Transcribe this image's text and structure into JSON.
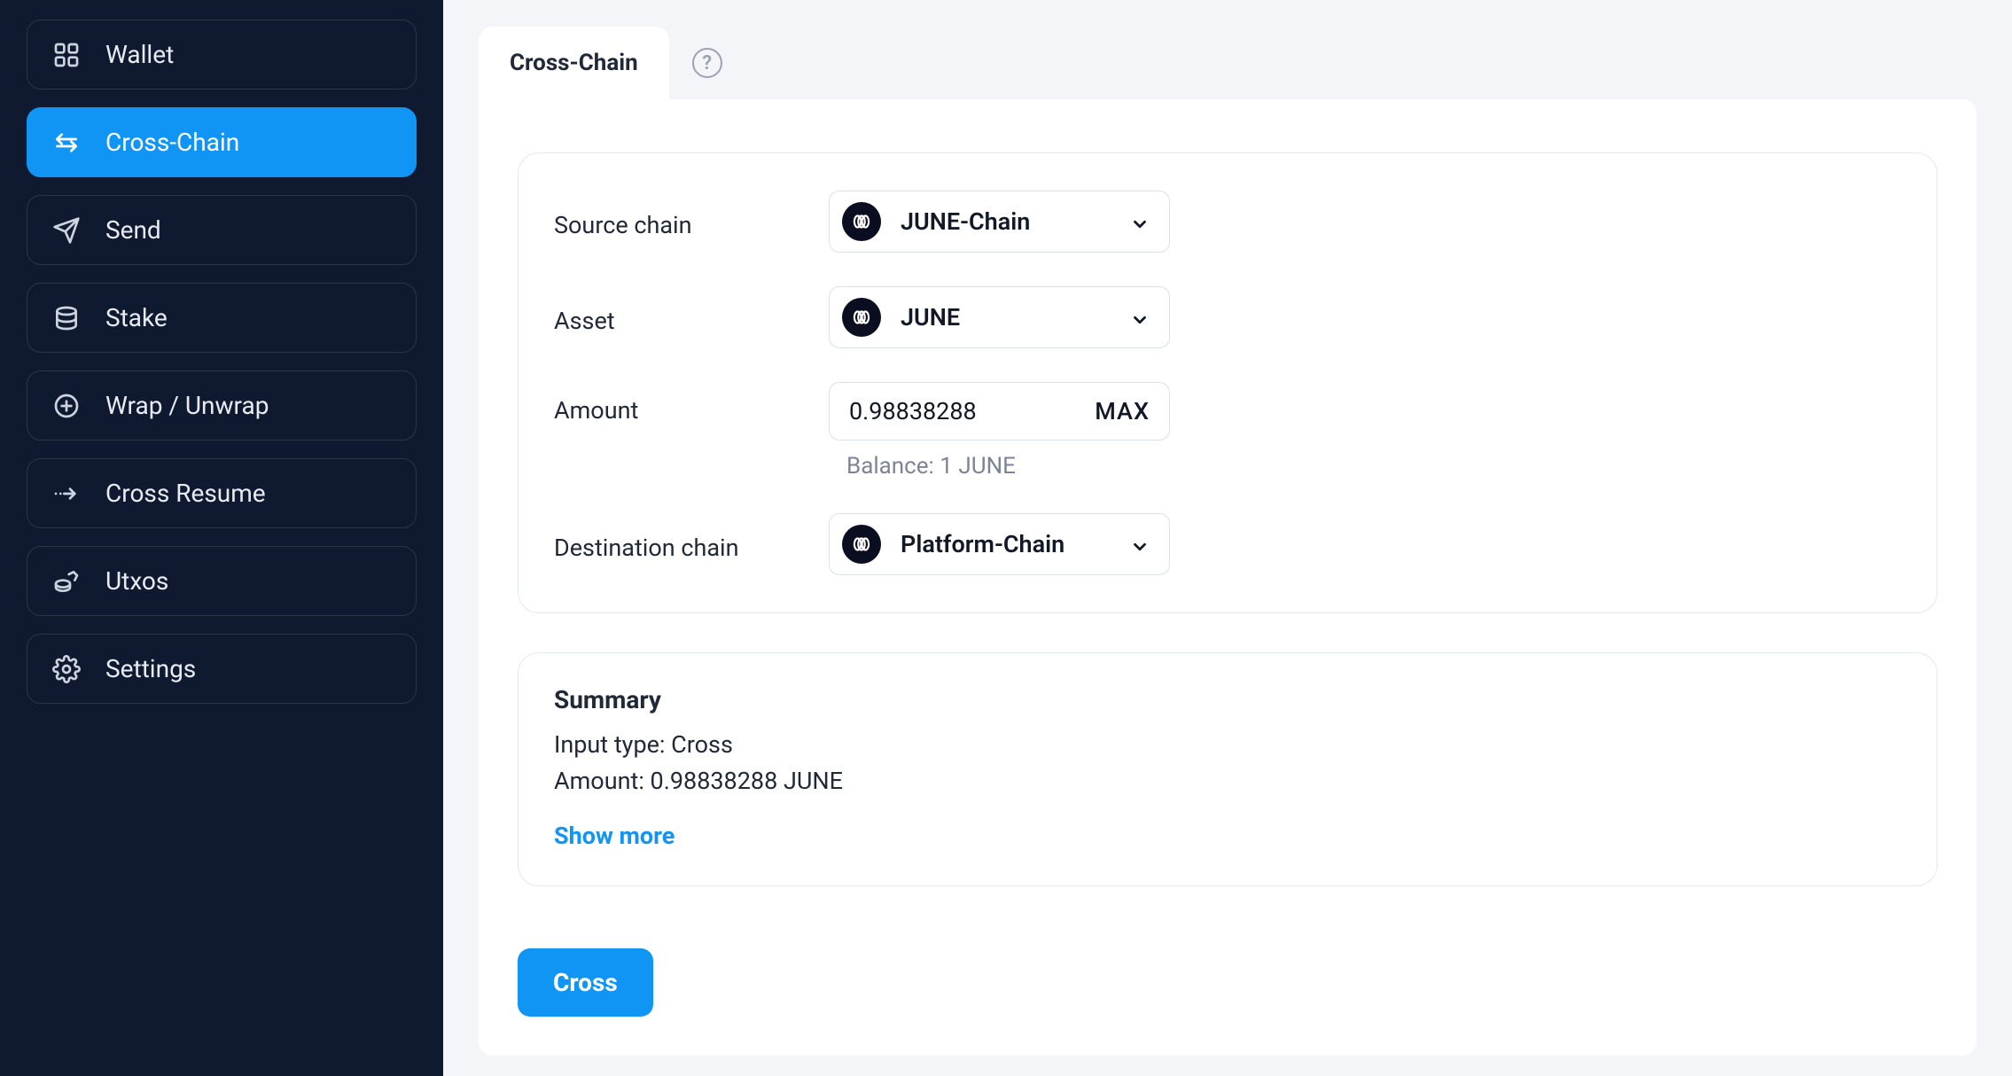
{
  "sidebar": {
    "items": [
      {
        "label": "Wallet"
      },
      {
        "label": "Cross-Chain"
      },
      {
        "label": "Send"
      },
      {
        "label": "Stake"
      },
      {
        "label": "Wrap / Unwrap"
      },
      {
        "label": "Cross Resume"
      },
      {
        "label": "Utxos"
      },
      {
        "label": "Settings"
      }
    ]
  },
  "tabs": {
    "active": "Cross-Chain"
  },
  "form": {
    "source_label": "Source chain",
    "source_value": "JUNE-Chain",
    "asset_label": "Asset",
    "asset_value": "JUNE",
    "amount_label": "Amount",
    "amount_value": "0.98838288",
    "amount_max": "MAX",
    "balance_text": "Balance: 1 JUNE",
    "destination_label": "Destination chain",
    "destination_value": "Platform-Chain"
  },
  "summary": {
    "title": "Summary",
    "line1": "Input type: Cross",
    "line2": "Amount: 0.98838288 JUNE",
    "show_more": "Show more"
  },
  "action": {
    "button_label": "Cross"
  }
}
